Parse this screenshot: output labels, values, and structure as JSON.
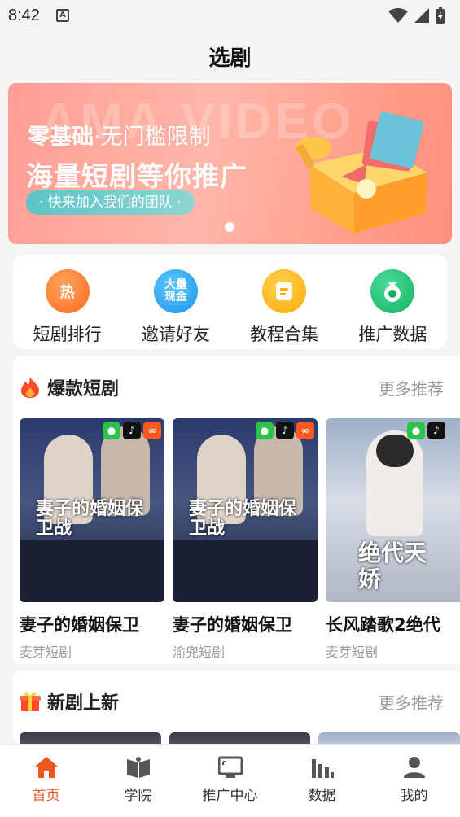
{
  "status_bar": {
    "time": "8:42",
    "notif_glyph": "A"
  },
  "header": {
    "title": "选剧"
  },
  "banner": {
    "watermark": "AMA VIDEO",
    "line1_bold": "零基础",
    "line1_light": "·无门槛限制",
    "line2": "海量短剧等你推广",
    "pill": "· 快来加入我们的团队 ·"
  },
  "quick_actions": [
    {
      "label": "短剧排行",
      "glyph": "热",
      "color": "#ff7a2e",
      "icon": "hot-icon"
    },
    {
      "label": "邀请好友",
      "glyph": "大量现金",
      "color": "#2fa8f0",
      "icon": "cash-icon"
    },
    {
      "label": "教程合集",
      "glyph": "≡",
      "color": "#ffb81c",
      "icon": "tutorial-icon"
    },
    {
      "label": "推广数据",
      "glyph": "¥",
      "color": "#22c27a",
      "icon": "money-bag-icon"
    }
  ],
  "sections": [
    {
      "title": "爆款短剧",
      "more": "更多推荐",
      "icon": "fire-icon",
      "cards": [
        {
          "title": "妻子的婚姻保卫",
          "source": "麦芽短剧",
          "poster_text": "妻子的婚姻保卫战",
          "platforms": [
            "wechat",
            "douyin",
            "kuaishou"
          ]
        },
        {
          "title": "妻子的婚姻保卫",
          "source": "渝兜短剧",
          "poster_text": "妻子的婚姻保卫战",
          "platforms": [
            "wechat",
            "douyin",
            "kuaishou"
          ]
        },
        {
          "title": "长风踏歌2绝代",
          "source": "麦芽短剧",
          "poster_text": "绝代天娇",
          "platforms": [
            "wechat",
            "douyin"
          ]
        }
      ]
    },
    {
      "title": "新剧上新",
      "more": "更多推荐",
      "icon": "gift-icon"
    }
  ],
  "tabbar": [
    {
      "label": "首页",
      "icon": "home-icon",
      "active": true
    },
    {
      "label": "学院",
      "icon": "book-icon",
      "active": false
    },
    {
      "label": "推广中心",
      "icon": "monitor-icon",
      "active": false
    },
    {
      "label": "数据",
      "icon": "bar-chart-icon",
      "active": false
    },
    {
      "label": "我的",
      "icon": "user-icon",
      "active": false
    }
  ],
  "colors": {
    "accent": "#f0571e",
    "banner": "#ffa08d"
  }
}
